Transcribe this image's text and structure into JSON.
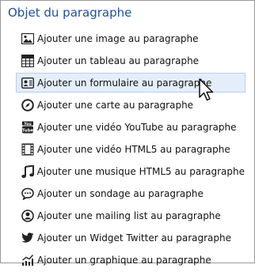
{
  "panel": {
    "title": "Objet du paragraphe",
    "items": [
      {
        "icon": "image-icon",
        "label": "Ajouter une image au paragraphe"
      },
      {
        "icon": "table-icon",
        "label": "Ajouter un tableau au paragraphe"
      },
      {
        "icon": "form-icon",
        "label": "Ajouter un formulaire au paragraphe"
      },
      {
        "icon": "compass-icon",
        "label": "Ajouter une carte au paragraphe"
      },
      {
        "icon": "youtube-icon",
        "label": "Ajouter une vidéo YouTube au paragraphe"
      },
      {
        "icon": "film-icon",
        "label": "Ajouter une vidéo HTML5 au paragraphe"
      },
      {
        "icon": "music-note-icon",
        "label": "Ajouter une musique HTML5 au paragraphe"
      },
      {
        "icon": "poll-icon",
        "label": "Ajouter un sondage au paragraphe"
      },
      {
        "icon": "mailing-list-icon",
        "label": "Ajouter une mailing list au paragraphe"
      },
      {
        "icon": "twitter-icon",
        "label": "Ajouter un Widget Twitter au paragraphe"
      },
      {
        "icon": "chart-icon",
        "label": "Ajouter un graphique au paragraphe"
      }
    ],
    "hovered_index": 2
  },
  "colors": {
    "title": "#1e4f9c",
    "hover_bg": "#e4eefb",
    "hover_border": "#b7cfee"
  }
}
